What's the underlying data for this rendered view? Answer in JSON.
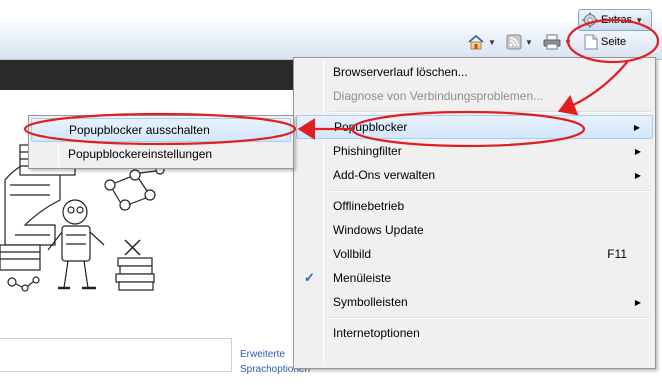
{
  "toolbar": {
    "seite_label": "Seite",
    "extras_label": "Extras",
    "icons": [
      "home-icon",
      "rss-feed-icon",
      "print-icon",
      "page-icon",
      "gear-icon"
    ]
  },
  "main_menu": {
    "items": [
      {
        "label": "Browserverlauf löschen..."
      },
      {
        "label": "Diagnose von Verbindungsproblemen..."
      },
      {
        "label": "Popupblocker"
      },
      {
        "label": "Phishingfilter"
      },
      {
        "label": "Add-Ons verwalten"
      },
      {
        "label": "Offlinebetrieb"
      },
      {
        "label": "Windows Update"
      },
      {
        "label": "Vollbild",
        "shortcut": "F11"
      },
      {
        "label": "Menüleiste"
      },
      {
        "label": "Symbolleisten"
      },
      {
        "label": "Internetoptionen"
      }
    ]
  },
  "sub_menu": {
    "items": [
      {
        "label": "Popupblocker ausschalten"
      },
      {
        "label": "Popupblockereinstellungen"
      }
    ]
  },
  "page": {
    "links": [
      "Erweiterte",
      "Sprachoptionen"
    ]
  },
  "colors": {
    "annotation_red": "#e02020",
    "highlight": "#d3e6fb",
    "check_blue": "#2465c4"
  }
}
